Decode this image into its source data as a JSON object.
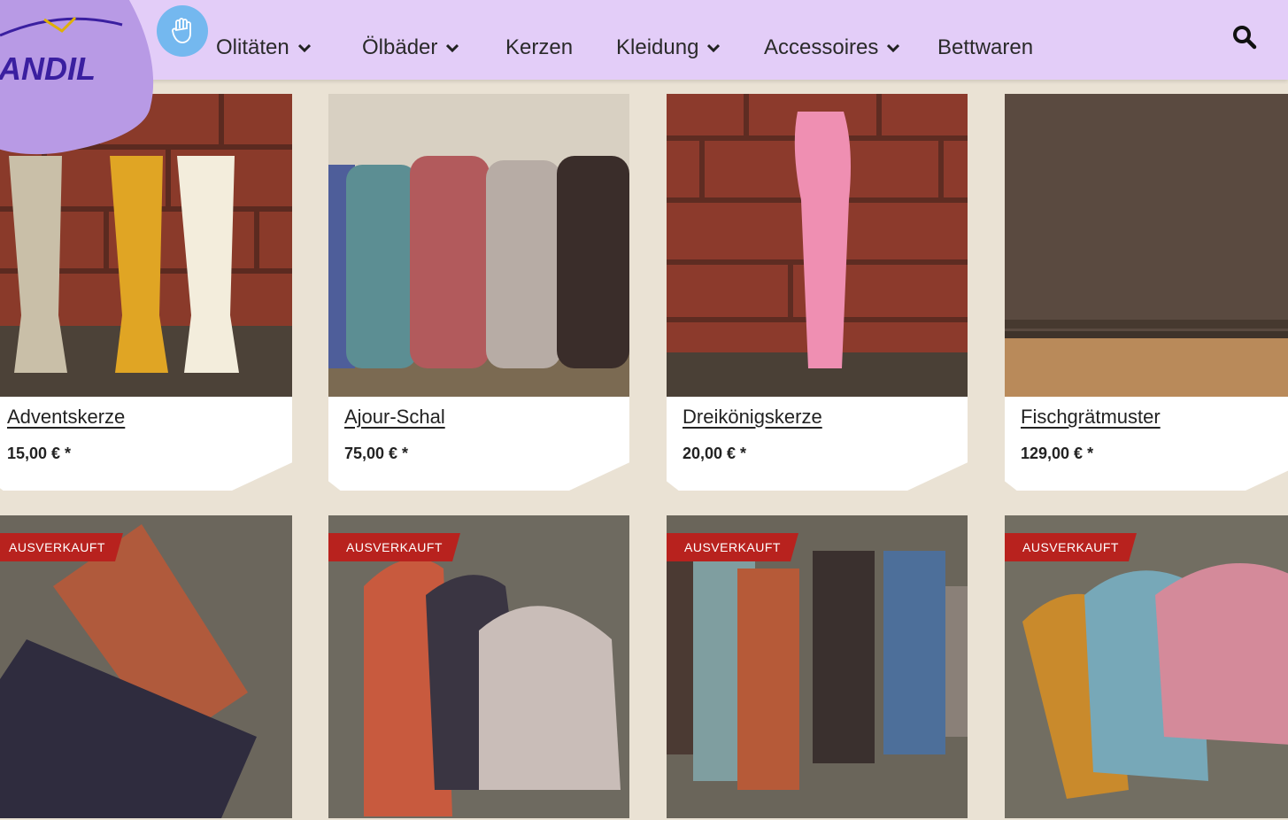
{
  "brand": {
    "logo_text": "ANDIL",
    "accent": "#e3cdf8",
    "logo_color": "#b89ae5"
  },
  "nav": {
    "items": [
      {
        "label": "Olitäten",
        "dropdown": true
      },
      {
        "label": "Ölbäder",
        "dropdown": true
      },
      {
        "label": "Kerzen",
        "dropdown": false
      },
      {
        "label": "Kleidung",
        "dropdown": true
      },
      {
        "label": "Accessoires",
        "dropdown": true
      },
      {
        "label": "Bettwaren",
        "dropdown": false
      }
    ],
    "search_icon": "search-icon",
    "hand_icon": "hand-icon"
  },
  "products": [
    {
      "title": "Adventskerze",
      "price": "15,00 € *",
      "image": "candles-image"
    },
    {
      "title": "Ajour-Schal",
      "price": "75,00 € *",
      "image": "scarves-image"
    },
    {
      "title": "Dreikönigskerze",
      "price": "20,00 € *",
      "image": "pink-candle-image"
    },
    {
      "title": "Fischgrätmuster",
      "price": "129,00 € *",
      "image": "herringbone-fabric-image"
    }
  ],
  "soldout_products": [
    {
      "badge": "AUSVERKAUFT",
      "image": "wrist-warmers-image"
    },
    {
      "badge": "AUSVERKAUFT",
      "image": "beanies-image"
    },
    {
      "badge": "AUSVERKAUFT",
      "image": "leg-warmers-image"
    },
    {
      "badge": "AUSVERKAUFT",
      "image": "colorblock-beanies-image"
    }
  ],
  "colors": {
    "badge_red": "#b8221e",
    "background": "#eae2d4"
  }
}
